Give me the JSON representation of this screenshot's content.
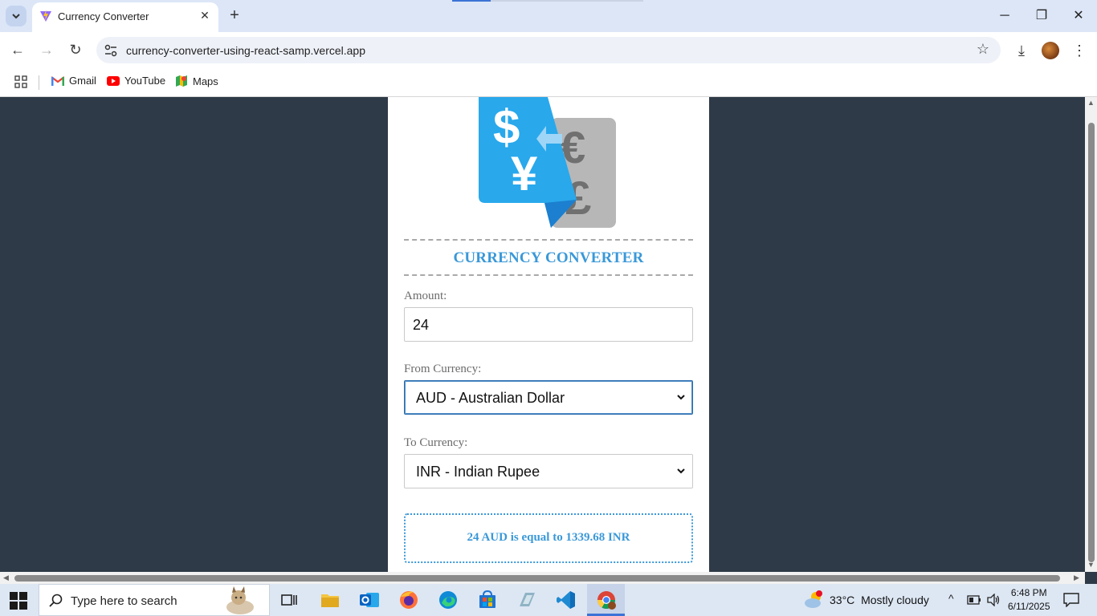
{
  "browser": {
    "tab_title": "Currency Converter",
    "url": "currency-converter-using-react-samp.vercel.app",
    "bookmarks": [
      {
        "label": "Gmail"
      },
      {
        "label": "YouTube"
      },
      {
        "label": "Maps"
      }
    ]
  },
  "app": {
    "title": "CURRENCY CONVERTER",
    "amount_label": "Amount:",
    "amount_value": "24",
    "from_label": "From Currency:",
    "from_value": "AUD - Australian Dollar",
    "to_label": "To Currency:",
    "to_value": "INR - Indian Rupee",
    "result_text": "24 AUD is equal to 1339.68 INR",
    "accent_color": "#3a98d8",
    "page_background": "#2e3a47"
  },
  "taskbar": {
    "search_placeholder": "Type here to search",
    "weather_temp": "33°C",
    "weather_text": "Mostly cloudy",
    "time": "6:48 PM",
    "date": "6/11/2025"
  }
}
